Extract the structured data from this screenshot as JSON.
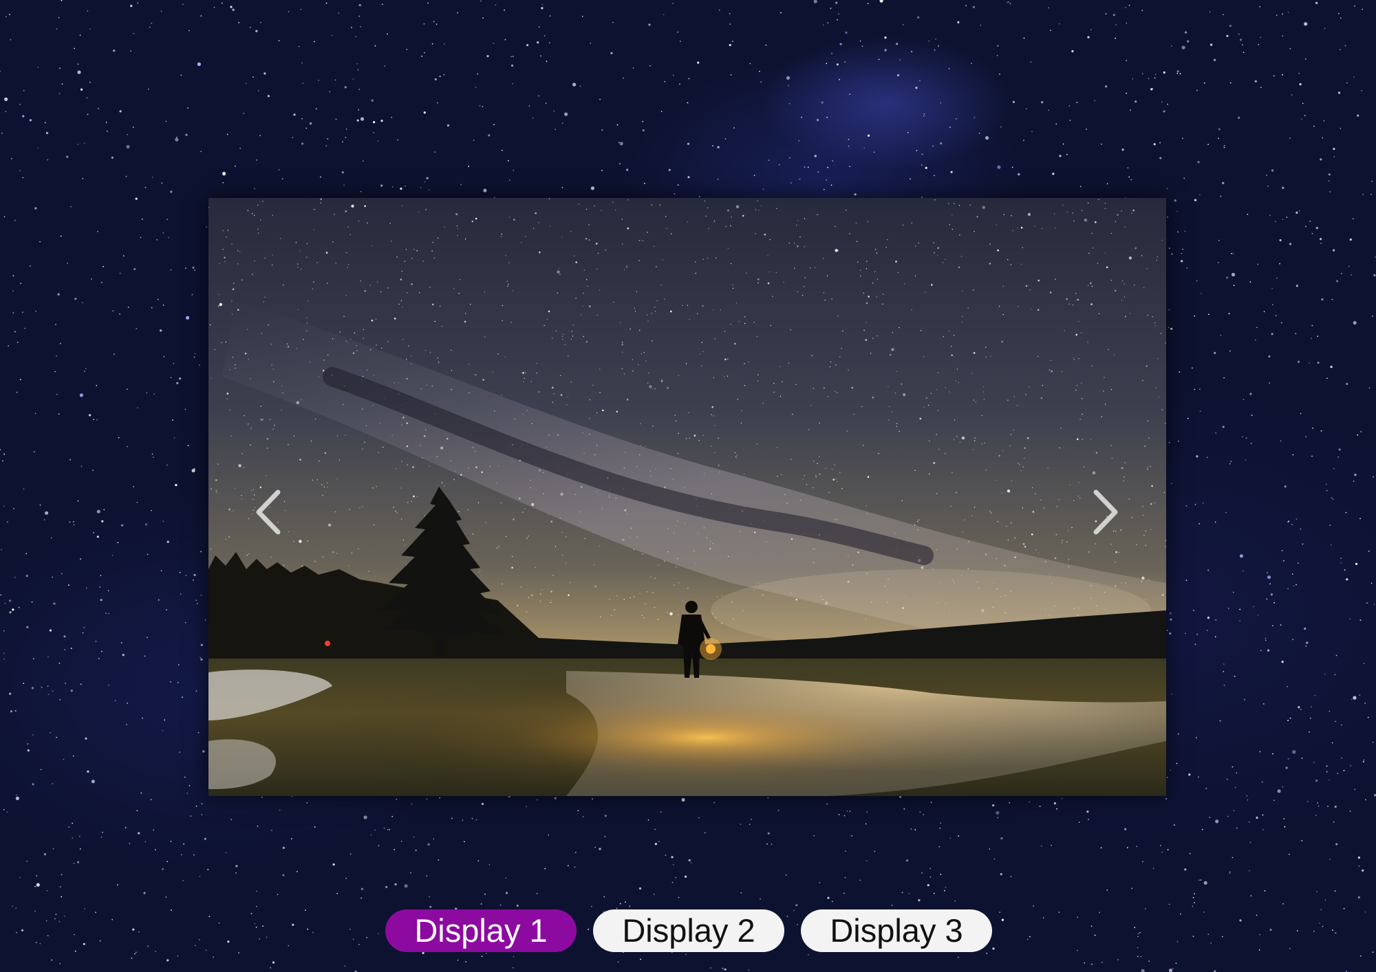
{
  "gallery": {
    "slide": {
      "image_desc": "night-sky-milky-way-person-with-lantern"
    },
    "prev_icon": "chevron-left-icon",
    "next_icon": "chevron-right-icon",
    "tabs": [
      {
        "label": "Display 1",
        "active": true
      },
      {
        "label": "Display 2",
        "active": false
      },
      {
        "label": "Display 3",
        "active": false
      }
    ]
  },
  "colors": {
    "background": "#0d1230",
    "active_tab": "#8d0aa0",
    "inactive_tab": "#f3f3f3"
  }
}
